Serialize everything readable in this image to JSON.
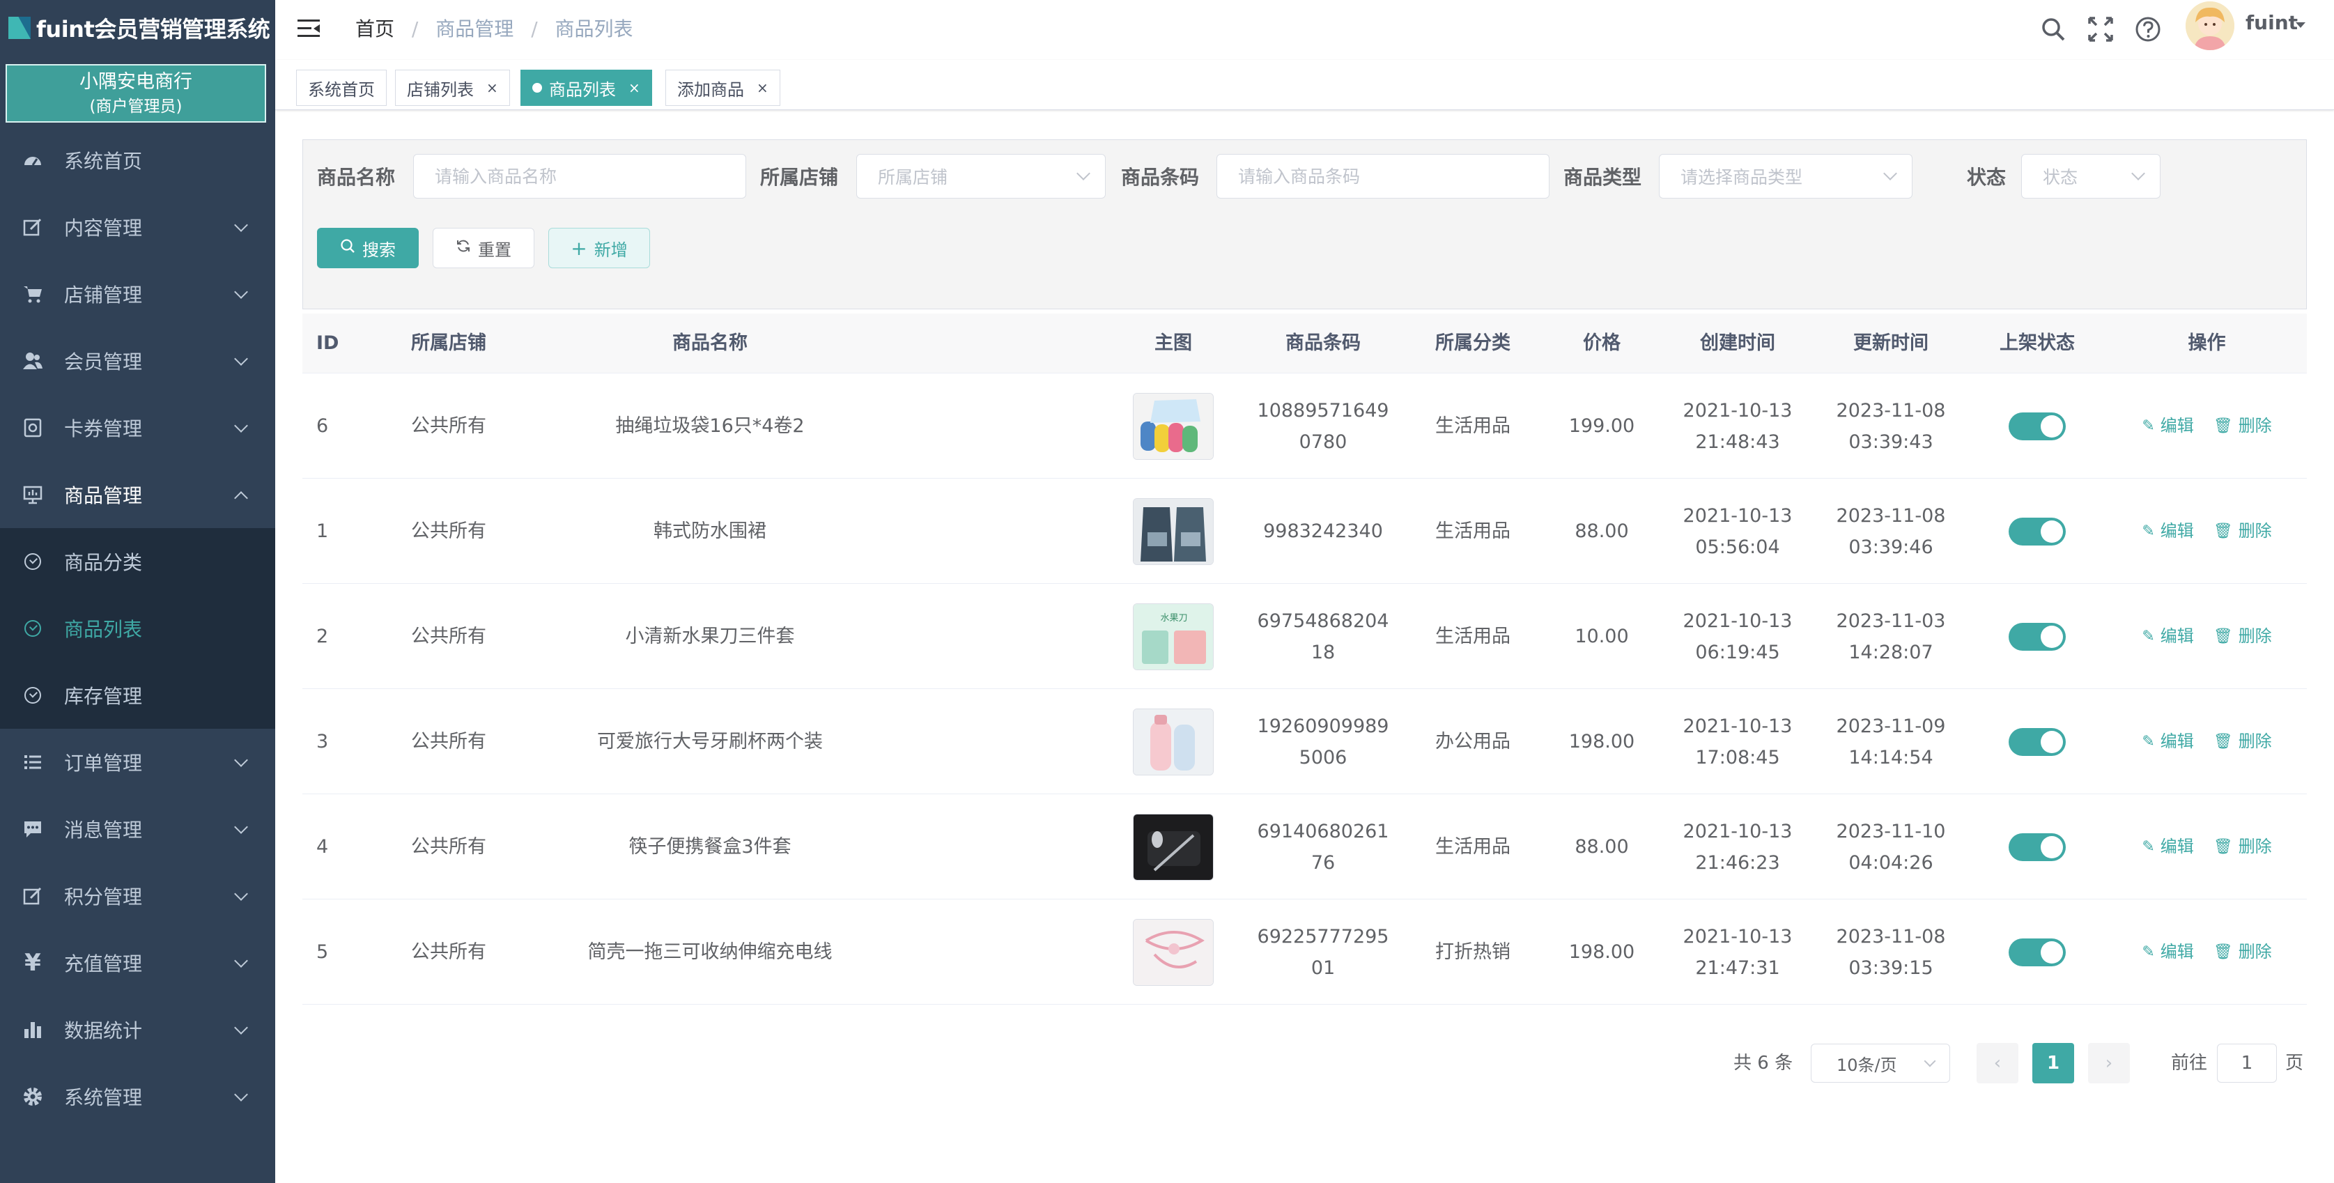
{
  "app": {
    "title": "fuint会员营销管理系统",
    "merchant_name": "小隅安电商行",
    "merchant_role": "(商户管理员)",
    "accent_color": "#3fa9a5"
  },
  "sidebar": {
    "items": [
      {
        "label": "系统首页",
        "icon": "dashboard-icon"
      },
      {
        "label": "内容管理",
        "icon": "edit-icon"
      },
      {
        "label": "店铺管理",
        "icon": "cart-icon"
      },
      {
        "label": "会员管理",
        "icon": "users-icon"
      },
      {
        "label": "卡券管理",
        "icon": "coupon-icon"
      },
      {
        "label": "商品管理",
        "icon": "monitor-icon"
      },
      {
        "label": "订单管理",
        "icon": "list-icon"
      },
      {
        "label": "消息管理",
        "icon": "message-icon"
      },
      {
        "label": "积分管理",
        "icon": "points-icon"
      },
      {
        "label": "充值管理",
        "icon": "yen-icon"
      },
      {
        "label": "数据统计",
        "icon": "chart-icon"
      },
      {
        "label": "系统管理",
        "icon": "gear-icon"
      }
    ],
    "sub_items": [
      {
        "label": "商品分类"
      },
      {
        "label": "商品列表",
        "active": true
      },
      {
        "label": "库存管理"
      }
    ]
  },
  "header": {
    "breadcrumb": [
      "首页",
      "商品管理",
      "商品列表"
    ],
    "user_name": "fuint"
  },
  "tags": [
    {
      "label": "系统首页"
    },
    {
      "label": "店铺列表",
      "closable": true
    },
    {
      "label": "商品列表",
      "closable": true,
      "active": true
    },
    {
      "label": "添加商品",
      "closable": true
    }
  ],
  "tag_close": "×",
  "search": {
    "name_label": "商品名称",
    "name_placeholder": "请输入商品名称",
    "store_label": "所属店铺",
    "store_placeholder": "所属店铺",
    "barcode_label": "商品条码",
    "barcode_placeholder": "请输入商品条码",
    "type_label": "商品类型",
    "type_placeholder": "请选择商品类型",
    "status_label": "状态",
    "status_placeholder": "状态",
    "search_button": "搜索",
    "reset_button": "重置",
    "add_button": "新增"
  },
  "table": {
    "columns": [
      "ID",
      "所属店铺",
      "商品名称",
      "主图",
      "商品条码",
      "所属分类",
      "价格",
      "创建时间",
      "更新时间",
      "上架状态",
      "操作"
    ],
    "edit_label": "编辑",
    "delete_label": "删除",
    "rows": [
      {
        "id": "6",
        "store": "公共所有",
        "name": "抽绳垃圾袋16只*4卷2",
        "barcode": "108895716490780",
        "category": "生活用品",
        "price": "199.00",
        "created": "2021-10-13 21:48:43",
        "updated": "2023-11-08 03:39:43",
        "on_shelf": true
      },
      {
        "id": "1",
        "store": "公共所有",
        "name": "韩式防水围裙",
        "barcode": "9983242340",
        "category": "生活用品",
        "price": "88.00",
        "created": "2021-10-13 05:56:04",
        "updated": "2023-11-08 03:39:46",
        "on_shelf": true
      },
      {
        "id": "2",
        "store": "公共所有",
        "name": "小清新水果刀三件套",
        "barcode": "6975486820418",
        "category": "生活用品",
        "price": "10.00",
        "created": "2021-10-13 06:19:45",
        "updated": "2023-11-03 14:28:07",
        "on_shelf": true
      },
      {
        "id": "3",
        "store": "公共所有",
        "name": "可爱旅行大号牙刷杯两个装",
        "barcode": "192609099895006",
        "category": "办公用品",
        "price": "198.00",
        "created": "2021-10-13 17:08:45",
        "updated": "2023-11-09 14:14:54",
        "on_shelf": true
      },
      {
        "id": "4",
        "store": "公共所有",
        "name": "筷子便携餐盒3件套",
        "barcode": "6914068026176",
        "category": "生活用品",
        "price": "88.00",
        "created": "2021-10-13 21:46:23",
        "updated": "2023-11-10 04:04:26",
        "on_shelf": true
      },
      {
        "id": "5",
        "store": "公共所有",
        "name": "简壳一拖三可收纳伸缩充电线",
        "barcode": "6922577729501",
        "category": "打折热销",
        "price": "198.00",
        "created": "2021-10-13 21:47:31",
        "updated": "2023-11-08 03:39:15",
        "on_shelf": true
      }
    ]
  },
  "pagination": {
    "total_text": "共 6 条",
    "page_size": "10条/页",
    "current_page": "1",
    "prev": "‹",
    "next": "›",
    "goto_label": "前往",
    "goto_value": "1",
    "page_unit": "页"
  }
}
